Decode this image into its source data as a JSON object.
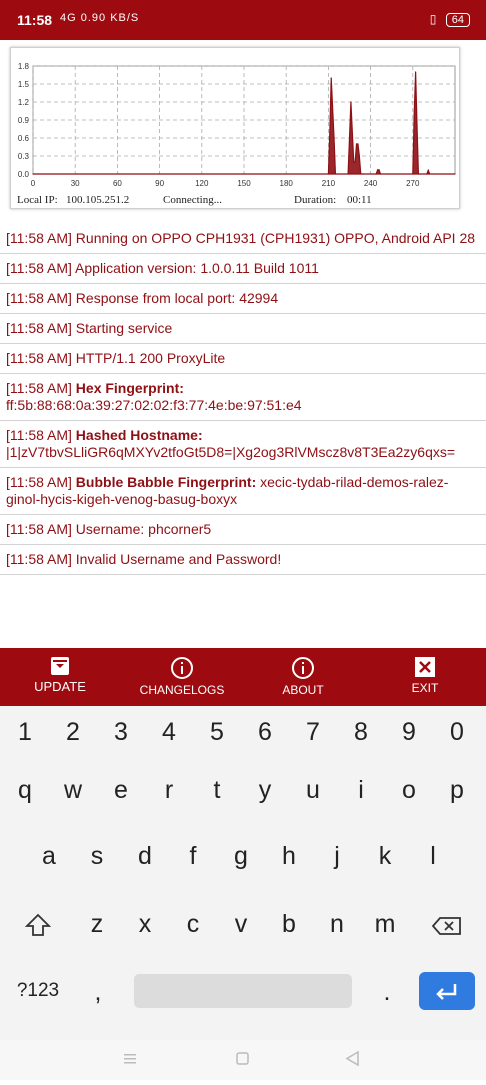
{
  "status": {
    "time": "11:58",
    "signal": "4G 0.90 KB/S",
    "battery": "64"
  },
  "chart": {
    "yticks": [
      "1.8",
      "1.5",
      "1.2",
      "0.9",
      "0.6",
      "0.3",
      "0.0"
    ],
    "xticks": [
      "0",
      "30",
      "60",
      "90",
      "120",
      "150",
      "180",
      "210",
      "240",
      "270"
    ],
    "local_ip_label": "Local IP:",
    "local_ip_value": "100.105.251.2",
    "connection_status": "Connecting...",
    "duration_label": "Duration:",
    "duration_value": "00:11"
  },
  "chart_data": {
    "type": "area",
    "x": [
      0,
      210,
      211,
      212,
      214,
      215,
      216,
      224,
      225,
      226,
      228,
      229,
      230,
      231,
      232,
      233,
      234,
      235,
      244,
      245,
      246,
      247,
      252,
      270,
      271,
      272,
      273,
      274,
      275,
      280,
      281,
      282,
      300
    ],
    "values": [
      0,
      0,
      0.7,
      1.6,
      0.6,
      0,
      0,
      0,
      0.6,
      1.2,
      0.2,
      0.2,
      0.5,
      0.5,
      0.3,
      0,
      0,
      0,
      0,
      0.07,
      0.07,
      0,
      0,
      0,
      1.0,
      1.7,
      0.8,
      0,
      0,
      0,
      0.06,
      0,
      0
    ],
    "ylim": [
      0,
      1.8
    ],
    "xlim": [
      0,
      300
    ],
    "grid": true,
    "color": "#8e0f14"
  },
  "log": [
    {
      "time": "[11:58 AM]",
      "label": "",
      "text": "Running on OPPO CPH1931 (CPH1931) OPPO, Android API 28"
    },
    {
      "time": "[11:58 AM]",
      "label": "",
      "text": "Application version: 1.0.0.11 Build 1011"
    },
    {
      "time": "[11:58 AM]",
      "label": "",
      "text": "Response from local port: 42994"
    },
    {
      "time": "[11:58 AM]",
      "label": "",
      "text": "Starting service"
    },
    {
      "time": "[11:58 AM]",
      "label": "",
      "text": "HTTP/1.1 200 ProxyLite"
    },
    {
      "time": "[11:58 AM]",
      "label": "Hex Fingerprint:",
      "text": "ff:5b:88:68:0a:39:27:02:02:f3:77:4e:be:97:51:e4"
    },
    {
      "time": "[11:58 AM]",
      "label": "Hashed Hostname:",
      "text": "|1|zV7tbvSLliGR6qMXYv2tfoGt5D8=|Xg2og3RlVMscz8v8T3Ea2zy6qxs="
    },
    {
      "time": "[11:58 AM]",
      "label": "Bubble Babble Fingerprint:",
      "text": "xecic-tydab-rilad-demos-ralez-ginol-hycis-kigeh-venog-basug-boxyx"
    },
    {
      "time": "[11:58 AM]",
      "label": "",
      "text": "Username: phcorner5"
    },
    {
      "time": "[11:58 AM]",
      "label": "",
      "text": "Invalid Username and Password!"
    }
  ],
  "bottom_nav": {
    "update": "UPDATE",
    "changelogs": "CHANGELOGS",
    "about": "ABOUT",
    "exit": "EXIT"
  },
  "keyboard": {
    "row1": [
      "1",
      "2",
      "3",
      "4",
      "5",
      "6",
      "7",
      "8",
      "9",
      "0"
    ],
    "row2": [
      "q",
      "w",
      "e",
      "r",
      "t",
      "y",
      "u",
      "i",
      "o",
      "p"
    ],
    "row3": [
      "a",
      "s",
      "d",
      "f",
      "g",
      "h",
      "j",
      "k",
      "l"
    ],
    "row4": [
      "z",
      "x",
      "c",
      "v",
      "b",
      "n",
      "m"
    ],
    "symbols": "?123",
    "comma": ",",
    "period": "."
  }
}
